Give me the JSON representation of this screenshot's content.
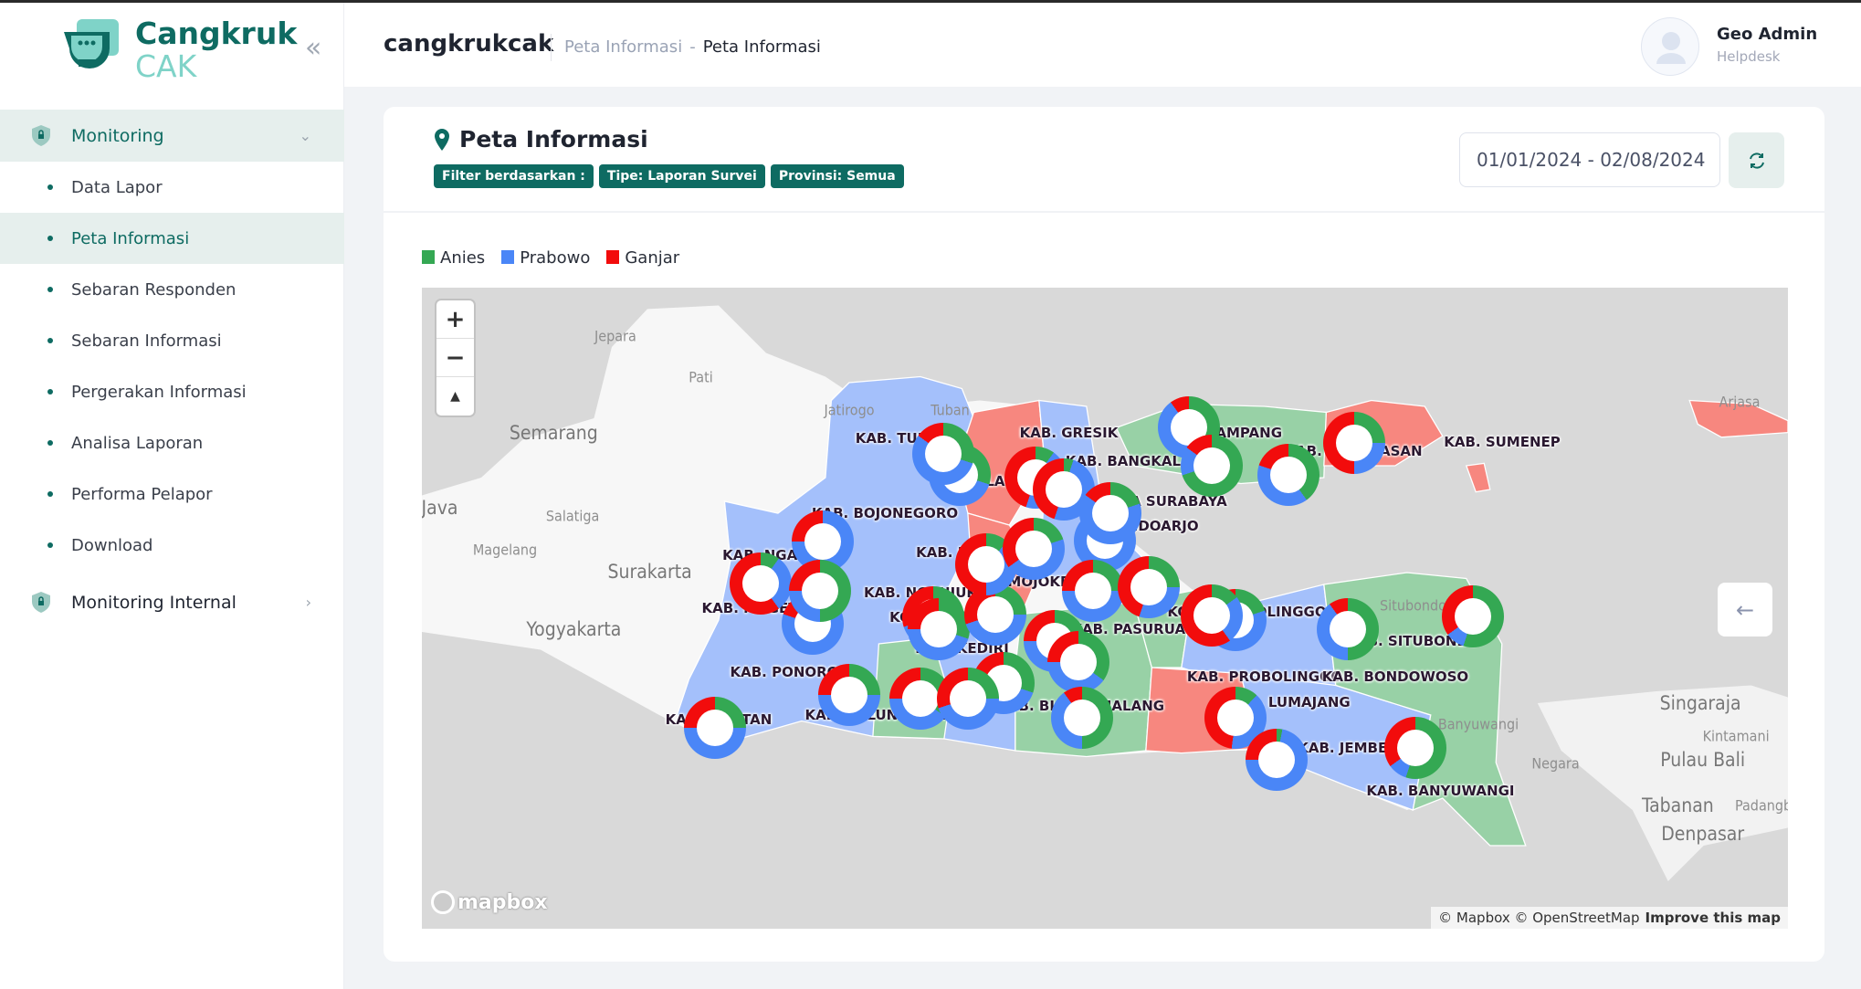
{
  "app": {
    "logo_line1": "Cangkruk",
    "logo_line2": "CAK",
    "brand": "cangkrukcak"
  },
  "breadcrumb": {
    "parent": "Peta Informasi",
    "separator": "-",
    "current": "Peta Informasi"
  },
  "user": {
    "name": "Geo Admin",
    "role": "Helpdesk"
  },
  "sidebar": {
    "group1": "Monitoring",
    "items": [
      {
        "label": "Data Lapor"
      },
      {
        "label": "Peta Informasi"
      },
      {
        "label": "Sebaran Responden"
      },
      {
        "label": "Sebaran Informasi"
      },
      {
        "label": "Pergerakan Informasi"
      },
      {
        "label": "Analisa Laporan"
      },
      {
        "label": "Performa Pelapor"
      },
      {
        "label": "Download"
      }
    ],
    "group2": "Monitoring Internal"
  },
  "page": {
    "title": "Peta Informasi",
    "filters": [
      "Filter berdasarkan :",
      "Tipe: Laporan Survei",
      "Provinsi: Semua"
    ],
    "date_range": "01/01/2024 - 02/08/2024"
  },
  "legend": [
    {
      "label": "Anies",
      "color": "#34a853"
    },
    {
      "label": "Prabowo",
      "color": "#4a86f7"
    },
    {
      "label": "Ganjar",
      "color": "#f20c0c"
    }
  ],
  "map": {
    "cities": [
      "Jepara",
      "Pati",
      "Jatirogo",
      "Tuban",
      "Semarang",
      "Java",
      "Salatiga",
      "Magelang",
      "Surakarta",
      "Yogyakarta",
      "Situbondo",
      "Banyuwangi",
      "Singaraja",
      "Kintamani",
      "Negara",
      "Pulau Bali",
      "Tabanan",
      "Denpasar",
      "Padangbai",
      "Arjasa"
    ],
    "regions": [
      "KAB. TUBAN",
      "KAB. GRESIK",
      "KAB. BANGKALAN",
      "KAB. SAMPANG",
      "KAB. PAMEKASAN",
      "KAB. SUMENEP",
      "KOTA SURABAYA",
      "KAB. SIDOARJO",
      "KAB. BOJONEGORO",
      "KAB. NGAWI",
      "KAB. MAGETAN",
      "KAB. NGANJUK",
      "KAB. LAMONGAN",
      "KAB. JOMBANG",
      "KAB. MOJOKERTO",
      "KOTA KEDIRI",
      "KAB. KEDIRI",
      "KAB. PASURUAN",
      "KOTA PROBOLINGGO",
      "KAB. PROBOLINGGO",
      "KAB. SITUBONDO",
      "KAB. BONDOWOSO",
      "KAB. LUMAJANG",
      "KAB. MALANG",
      "KAB. BLITAR",
      "KAB. TULUNGAGUNG",
      "KAB. PONOROGO",
      "KAB. PACITAN",
      "KAB. JEMBER",
      "KAB. BANYUWANGI"
    ],
    "markers_share_anies_prabowo_ganjar": [
      [
        30,
        60,
        10
      ],
      [
        30,
        55,
        15
      ],
      [
        10,
        45,
        45
      ],
      [
        5,
        50,
        45
      ],
      [
        0,
        75,
        25
      ],
      [
        10,
        30,
        60
      ],
      [
        10,
        70,
        20
      ],
      [
        50,
        25,
        25
      ],
      [
        25,
        45,
        30
      ],
      [
        30,
        45,
        25
      ],
      [
        25,
        45,
        30
      ],
      [
        12,
        38,
        50
      ],
      [
        20,
        45,
        35
      ],
      [
        10,
        80,
        10
      ],
      [
        20,
        65,
        15
      ],
      [
        25,
        50,
        25
      ],
      [
        25,
        30,
        45
      ],
      [
        45,
        45,
        10
      ],
      [
        70,
        15,
        15
      ],
      [
        40,
        40,
        20
      ],
      [
        25,
        25,
        50
      ],
      [
        20,
        70,
        10
      ],
      [
        15,
        25,
        60
      ],
      [
        50,
        40,
        10
      ],
      [
        55,
        10,
        35
      ],
      [
        20,
        55,
        25
      ],
      [
        35,
        40,
        25
      ],
      [
        25,
        50,
        25
      ],
      [
        35,
        40,
        25
      ],
      [
        30,
        40,
        30
      ],
      [
        25,
        45,
        30
      ],
      [
        50,
        40,
        10
      ],
      [
        25,
        50,
        25
      ],
      [
        12,
        40,
        48
      ],
      [
        3,
        72,
        25
      ],
      [
        55,
        10,
        35
      ]
    ],
    "controls": {
      "zoom_in": "+",
      "zoom_out": "−",
      "compass": "▲"
    },
    "back": "←",
    "mapbox_logo": "mapbox",
    "attribution": "© Mapbox © OpenStreetMap",
    "improve": "Improve this map"
  }
}
